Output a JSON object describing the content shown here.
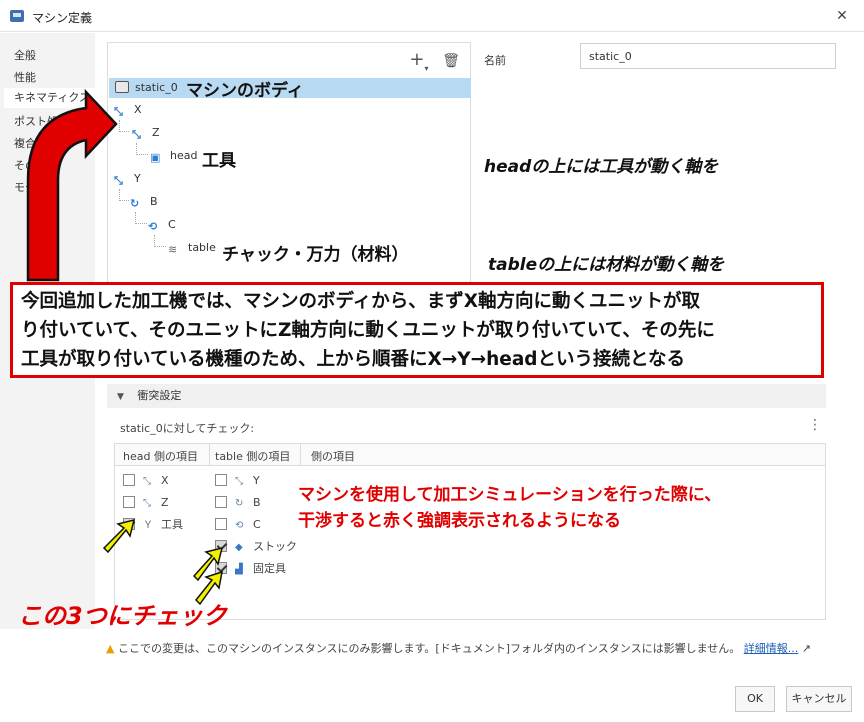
{
  "window": {
    "title": "マシン定義",
    "close_glyph": "✕"
  },
  "nav": {
    "items": [
      {
        "label": "全般"
      },
      {
        "label": "性能"
      },
      {
        "label": "キネマティクス"
      },
      {
        "label": "ポスト処"
      },
      {
        "label": "複合"
      },
      {
        "label": "その      定"
      },
      {
        "label": "モデ"
      }
    ]
  },
  "tree": {
    "toolbar": {
      "add_glyph": "+",
      "delete_glyph": "🗑"
    },
    "nodes": [
      {
        "label": "static_0",
        "icon": "machine-icon"
      },
      {
        "label": "X",
        "icon": "linear-axis-icon"
      },
      {
        "label": "Z",
        "icon": "linear-axis-icon"
      },
      {
        "label": "head",
        "icon": "head-icon"
      },
      {
        "label": "Y",
        "icon": "linear-axis-icon"
      },
      {
        "label": "B",
        "icon": "rotary-axis-icon"
      },
      {
        "label": "C",
        "icon": "rotary-axis-icon"
      },
      {
        "label": "table",
        "icon": "table-icon"
      }
    ]
  },
  "name_field": {
    "label": "名前",
    "value": "static_0"
  },
  "collision": {
    "section_title": "衝突設定",
    "check_label": "static_0に対してチェック:",
    "columns": [
      "head 側の項目",
      "table 側の項目",
      "側の項目"
    ],
    "head_items": [
      {
        "label": "X",
        "checked": false
      },
      {
        "label": "Z",
        "checked": false
      },
      {
        "label": "工具",
        "checked": true
      }
    ],
    "table_items": [
      {
        "label": "Y",
        "checked": false
      },
      {
        "label": "B",
        "checked": false
      },
      {
        "label": "C",
        "checked": false
      },
      {
        "label": "ストック",
        "checked": true
      },
      {
        "label": "固定具",
        "checked": true
      }
    ]
  },
  "footer": {
    "note": "ここでの変更は、このマシンのインスタンスにのみ影響します。[ドキュメント]フォルダ内のインスタンスには影響しません。",
    "link": "詳細情報...",
    "ok": "OK",
    "cancel": "キャンセル"
  },
  "annotations": {
    "machine_body": "マシンのボディ",
    "tool": "工具",
    "chuck": "チャック・万力（材料）",
    "head_axis": "headの上には工具が動く軸を",
    "table_axis": "tableの上には材料が動く軸を",
    "callout_lines": [
      "今回追加した加工機では、マシンのボディから、まずX軸方向に動くユニットが取",
      "り付いていて、そのユニットにZ軸方向に動くユニットが取り付いていて、その先に",
      "工具が取り付いている機種のため、上から順番にX→Y→headという接続となる"
    ],
    "collision_note_1": "マシンを使用して加工シミュレーションを行った際に、",
    "collision_note_2": "干渉すると赤く強調表示されるようになる",
    "check_these": "この3つにチェック"
  },
  "colors": {
    "accent": "#2a7fd4",
    "selection": "#b8d9f2",
    "annotation_red": "#e00000",
    "arrow_yellow": "#f2f200"
  }
}
